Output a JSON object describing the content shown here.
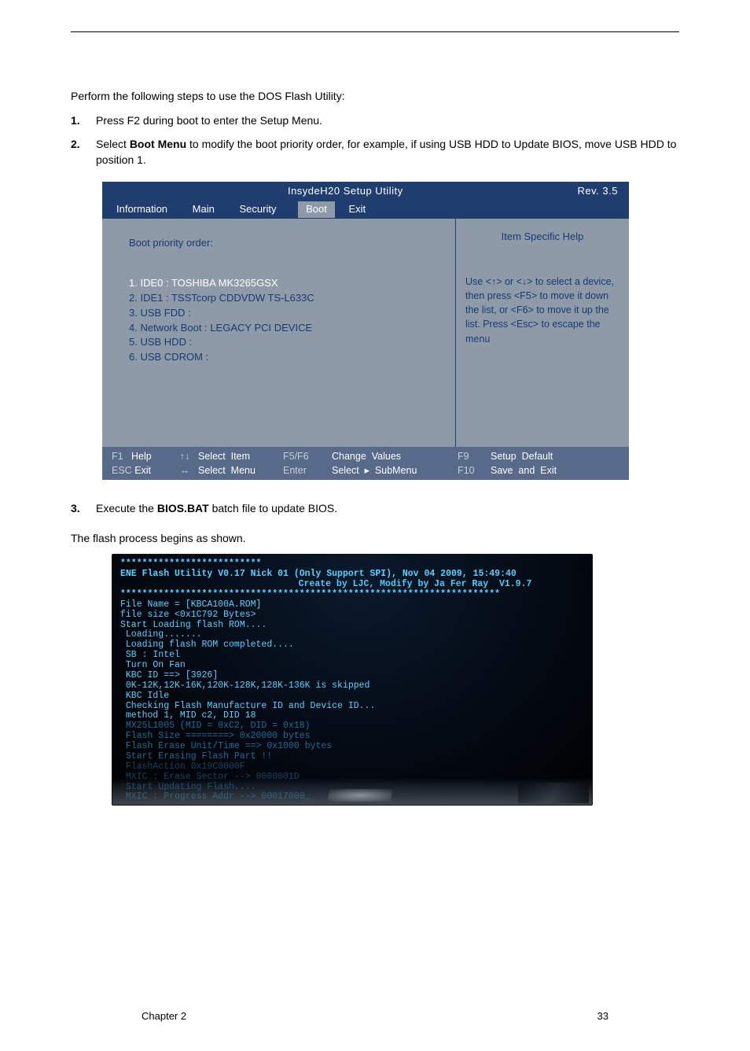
{
  "intro": "Perform the following steps to use the DOS Flash Utility:",
  "steps_top": [
    {
      "num": "1.",
      "html": "Press F2 during boot to enter the Setup Menu."
    },
    {
      "num": "2.",
      "html": "Select <b>Boot Menu</b> to modify the boot priority order, for example, if using USB HDD to Update BIOS, move USB HDD to position 1."
    }
  ],
  "bios": {
    "title": "InsydeH20 Setup Utility",
    "rev": "Rev. 3.5",
    "tabs": [
      "Information",
      "Main",
      "Security",
      "Boot",
      "Exit"
    ],
    "selected_tab": 3,
    "heading": "Boot priority order:",
    "items": [
      "1. IDE0 : TOSHIBA MK3265GSX",
      "2. IDE1 : TSSTcorp CDDVDW TS-L633C",
      "3. USB FDD :",
      "4. Network Boot : LEGACY PCI DEVICE",
      "5. USB HDD :",
      "6. USB CDROM :"
    ],
    "selected_item": 0,
    "help_title": "Item Specific Help",
    "help_body": "Use <↑> or <↓> to select a device, then press <F5> to move it down the list, or <F6> to move it up the list. Press <Esc> to escape the menu",
    "footer": {
      "row1": {
        "k1": "F1",
        "v1": "Help",
        "arr1": "↑↓",
        "v2": "Select  Item",
        "k2": "F5/F6",
        "v3": "Change  Values",
        "k3": "F9",
        "v4": "Setup  Default"
      },
      "row2": {
        "k1": "ESC",
        "v1": "Exit",
        "arr1": "↔",
        "v2": "Select  Menu",
        "k2": "Enter",
        "v3": "Select  ▸  SubMenu",
        "k3": "F10",
        "v4": "Save  and  Exit"
      }
    }
  },
  "steps_bottom": [
    {
      "num": "3.",
      "html": "Execute the <b>BIOS.BAT</b> batch file to update BIOS."
    }
  ],
  "sub_intro": "The flash process begins as shown.",
  "flash": {
    "hdr1_stars": "**************************",
    "hdr1": "ENE Flash Utility V0.17 Nick 01 (Only Support SPI), Nov 04 2009, 15:49:40",
    "hdr2": "Create by LJC, Modify by Ja Fer Ray  V1.9.7",
    "hdr2_stars": "**********************************************************************",
    "lines": [
      "File Name = [KBCA100A.ROM]",
      "file size <0x1C792 Bytes>",
      "Start Loading flash ROM....",
      " Loading.......",
      " Loading flash ROM completed....",
      " SB : Intel",
      " Turn On Fan",
      " KBC ID ==> [3926]",
      " 0K-12K,12K-16K,120K-128K,128K-136K is skipped",
      " KBC Idle",
      " Checking Flash Manufacture ID and Device ID...",
      " method 1, MID c2, DID 18",
      " MX25L1005 (MID = 0xC2, DID = 0x18)",
      " Flash Size ========> 0x20000 bytes",
      " Flash Erase Unit/Time ==> 0x1000 bytes",
      " Start Erasing Flash Part !!",
      " FlashAction 0x19C0000F",
      " MXIC : Erase Sector --> 0000001D",
      " Start Updating Flash....",
      " MXIC : Progress Addr --> 00017000_"
    ]
  },
  "footer": {
    "left": "Chapter 2",
    "right": "33"
  }
}
